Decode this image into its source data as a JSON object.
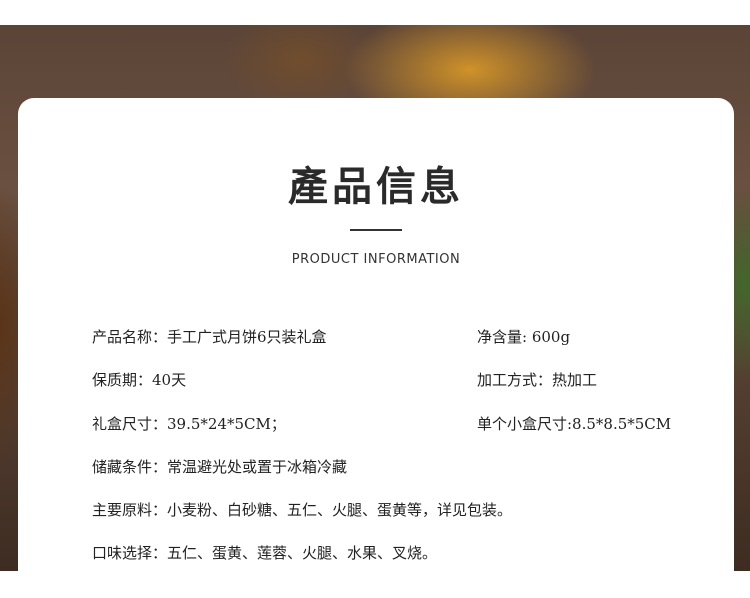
{
  "header": {
    "title": "產品信息",
    "subtitle": "PRODUCT INFORMATION"
  },
  "info_rows": [
    {
      "left": "产品名称：手工广式月饼6只装礼盒",
      "right": "净含量: 600g"
    },
    {
      "left": "保质期：40天",
      "right": "加工方式：热加工"
    },
    {
      "left": "礼盒尺寸：39.5*24*5CM；",
      "right": "单个小盒尺寸:8.5*8.5*5CM"
    },
    {
      "left": "储藏条件：常温避光处或置于冰箱冷藏"
    },
    {
      "left": "主要原料：小麦粉、白砂糖、五仁、火腿、蛋黄等，详见包装。"
    },
    {
      "left": "口味选择：五仁、蛋黄、莲蓉、火腿、水果、叉烧。"
    }
  ]
}
